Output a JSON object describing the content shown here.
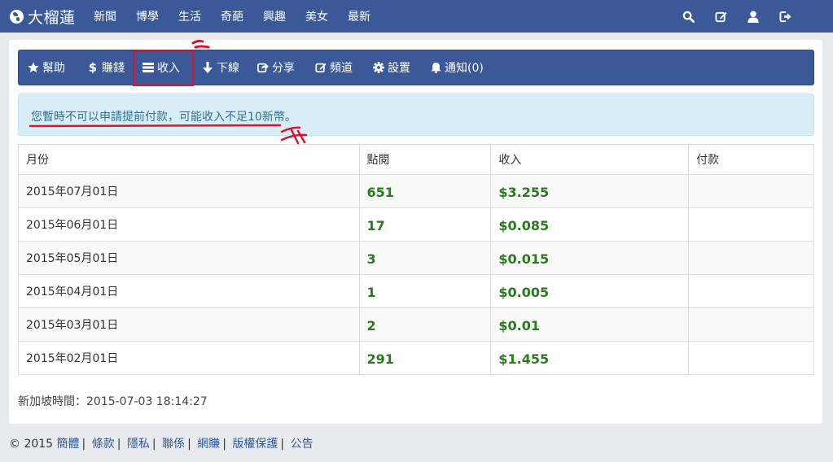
{
  "brand": {
    "name": "大榴蓮",
    "logo_icon": "globe-icon"
  },
  "nav": {
    "links": [
      "新聞",
      "博學",
      "生活",
      "奇葩",
      "興趣",
      "美女",
      "最新"
    ],
    "icons": [
      "search-icon",
      "edit-icon",
      "user-icon",
      "logout-icon"
    ]
  },
  "subnav": {
    "items": [
      {
        "label": "幫助",
        "icon": "star-icon"
      },
      {
        "label": "賺錢",
        "icon": "dollar-icon"
      },
      {
        "label": "收入",
        "icon": "list-icon"
      },
      {
        "label": "下線",
        "icon": "arrow-down-icon"
      },
      {
        "label": "分享",
        "icon": "share-icon"
      },
      {
        "label": "頻道",
        "icon": "edit-icon"
      },
      {
        "label": "設置",
        "icon": "gear-icon"
      },
      {
        "label": "通知(0)",
        "icon": "bell-icon"
      }
    ],
    "active": "收入"
  },
  "alert": {
    "message": "您暫時不可以申請提前付款，可能收入不足10新幣。"
  },
  "table": {
    "headers": [
      "月份",
      "點閱",
      "收入",
      "付款"
    ],
    "rows": [
      {
        "month": "2015年07月01日",
        "views": "651",
        "income": "$3.255",
        "payment": ""
      },
      {
        "month": "2015年06月01日",
        "views": "17",
        "income": "$0.085",
        "payment": ""
      },
      {
        "month": "2015年05月01日",
        "views": "3",
        "income": "$0.015",
        "payment": ""
      },
      {
        "month": "2015年04月01日",
        "views": "1",
        "income": "$0.005",
        "payment": ""
      },
      {
        "month": "2015年03月01日",
        "views": "2",
        "income": "$0.01",
        "payment": ""
      },
      {
        "month": "2015年02月01日",
        "views": "291",
        "income": "$1.455",
        "payment": ""
      }
    ]
  },
  "server_time": "新加坡時間：2015-07-03 18:14:27",
  "footer": {
    "copyright": "© 2015",
    "links": [
      "簡體",
      "條款",
      "隱私",
      "聯係",
      "網賺",
      "版權保護",
      "公告"
    ],
    "separator": "|"
  },
  "colors": {
    "nav_bg": "#3b5998",
    "alert_bg": "#d9edf7",
    "alert_text": "#31708f",
    "value_green": "#2a7a1e",
    "annotation_red": "#e0112b"
  }
}
